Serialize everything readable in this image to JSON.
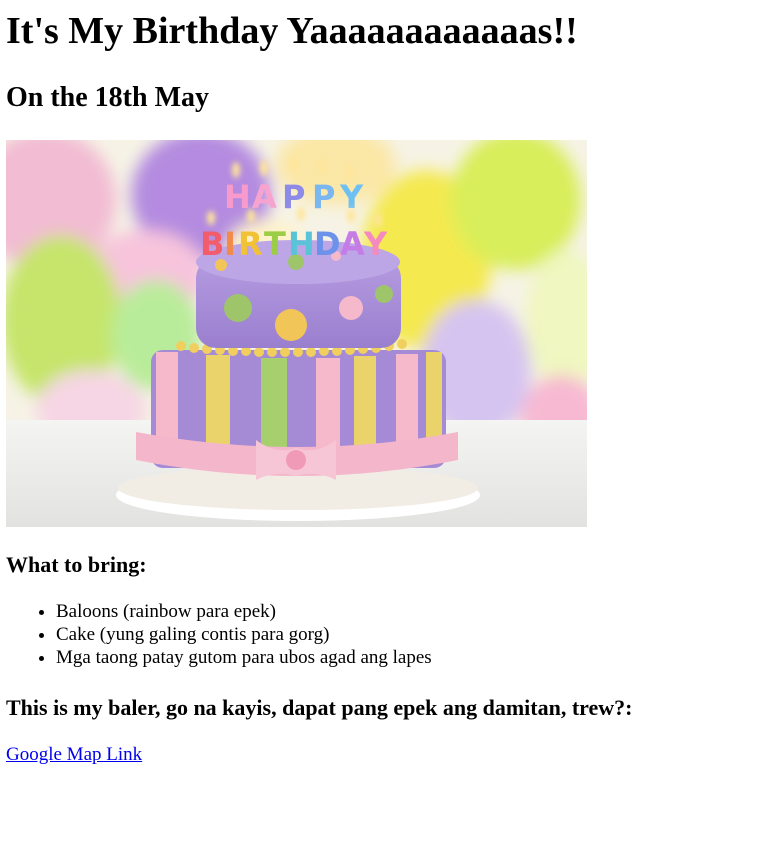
{
  "page": {
    "title": "It's My Birthday Yaaaaaaaaaaaas!!",
    "subtitle": "On the 18th May"
  },
  "photo": {
    "candle_letters_top": "HAPPY",
    "candle_letters_bottom": "BIRTHDAY"
  },
  "bring": {
    "heading": "What to bring:",
    "items": [
      "Baloons (rainbow para epek)",
      "Cake (yung galing contis para gorg)",
      "Mga taong patay gutom para ubos agad ang lapes"
    ]
  },
  "location": {
    "heading": "This is my baler, go na kayis, dapat pang epek ang damitan, trew?:",
    "link_label": "Google Map Link",
    "link_color": "#0000ee"
  }
}
